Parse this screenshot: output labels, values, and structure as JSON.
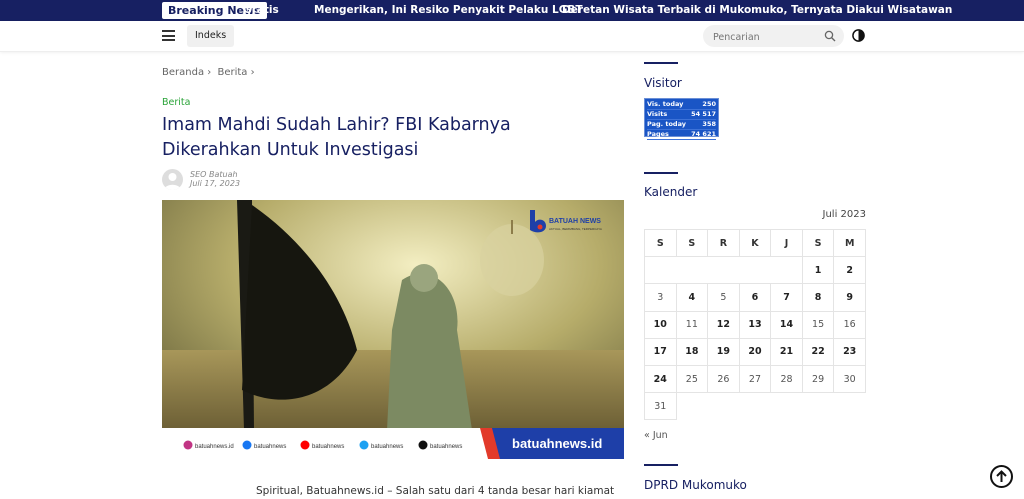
{
  "topbar": {
    "breaking_label": "Breaking News",
    "tickers": [
      "Gratis",
      "Mengerikan, Ini Resiko Penyakit Pelaku LGBT",
      "Deretan Wisata Terbaik di Mukomuko, Ternyata Diakui Wisatawan"
    ]
  },
  "nav": {
    "indeks_label": "Indeks",
    "search_placeholder": "Pencarian"
  },
  "breadcrumb": {
    "home": "Beranda",
    "category": "Berita",
    "sep": "›"
  },
  "article": {
    "category": "Berita",
    "title": "Imam Mahdi Sudah Lahir? FBI Kabarnya Dikerahkan Untuk Investigasi",
    "author": "SEO Batuah",
    "date": "Juli 17, 2023",
    "lead": "Spiritual, Batuahnews.id – Salah satu dari 4 tanda besar hari kiamat"
  },
  "hero": {
    "brand": "BATUAH NEWS",
    "brand_tagline": "AKTUAL, BERIMBANG, TERPERCAYA",
    "site": "batuahnews.id",
    "socials": [
      "batuahnews.id",
      "batuahnews",
      "batuahnews",
      "batuahnews",
      "batuahnews"
    ]
  },
  "sidebar": {
    "visitor_title": "Visitor",
    "counter": [
      {
        "label": "Vis. today",
        "value": "250"
      },
      {
        "label": "Visits",
        "value": "54 517"
      },
      {
        "label": "Pag. today",
        "value": "358"
      },
      {
        "label": "Pages",
        "value": "74 621"
      }
    ],
    "calendar_title": "Kalender",
    "calendar_month": "Juli 2023",
    "weekdays": [
      "S",
      "S",
      "R",
      "K",
      "J",
      "S",
      "M"
    ],
    "weeks": [
      [
        "",
        "",
        "",
        "",
        "",
        "1",
        "2"
      ],
      [
        "3",
        "4",
        "5",
        "6",
        "7",
        "8",
        "9"
      ],
      [
        "10",
        "11",
        "12",
        "13",
        "14",
        "15",
        "16"
      ],
      [
        "17",
        "18",
        "19",
        "20",
        "21",
        "22",
        "23"
      ],
      [
        "24",
        "25",
        "26",
        "27",
        "28",
        "29",
        "30"
      ],
      [
        "31",
        "",
        "",
        "",
        "",
        "",
        ""
      ]
    ],
    "bold_days": [
      "1",
      "2",
      "4",
      "6",
      "7",
      "8",
      "9",
      "10",
      "12",
      "13",
      "14",
      "17",
      "18",
      "19",
      "20",
      "21",
      "22",
      "23",
      "24"
    ],
    "prev_month": "« Jun",
    "dprd_title": "DPRD Mukomuko"
  },
  "colors": {
    "navy": "#172062",
    "green": "#2aa338"
  }
}
